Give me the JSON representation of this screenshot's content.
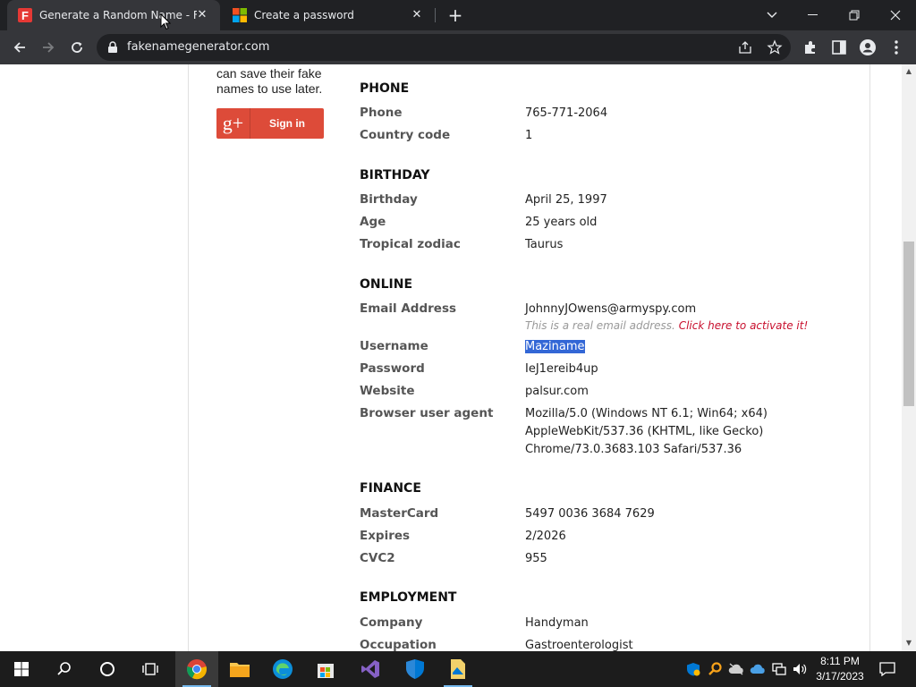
{
  "browser": {
    "tabs": [
      {
        "title": "Generate a Random Name - Fake Name Generator",
        "active": true
      },
      {
        "title": "Create a password",
        "active": false
      }
    ],
    "url": "fakenamegenerator.com"
  },
  "sidebar": {
    "text": "can save their fake names to use later.",
    "signin_label": "Sign in",
    "gplus_glyph": "g+"
  },
  "sections": {
    "phone": {
      "title": "PHONE",
      "phone_label": "Phone",
      "phone_value": "765-771-2064",
      "country_label": "Country code",
      "country_value": "1"
    },
    "birthday": {
      "title": "BIRTHDAY",
      "birthday_label": "Birthday",
      "birthday_value": "April 25, 1997",
      "age_label": "Age",
      "age_value": "25 years old",
      "zodiac_label": "Tropical zodiac",
      "zodiac_value": "Taurus"
    },
    "online": {
      "title": "ONLINE",
      "email_label": "Email Address",
      "email_value": "JohnnyJOwens@armyspy.com",
      "email_note": "This is a real email address.",
      "email_activate": "Click here to activate it!",
      "username_label": "Username",
      "username_value": "Maziname",
      "password_label": "Password",
      "password_value": "IeJ1ereib4up",
      "website_label": "Website",
      "website_value": "palsur.com",
      "ua_label": "Browser user agent",
      "ua_line1": "Mozilla/5.0 (Windows NT 6.1; Win64; x64)",
      "ua_line2": "AppleWebKit/537.36 (KHTML, like Gecko)",
      "ua_line3": "Chrome/73.0.3683.103 Safari/537.36"
    },
    "finance": {
      "title": "FINANCE",
      "card_label": "MasterCard",
      "card_value": "5497 0036 3684 7629",
      "expires_label": "Expires",
      "expires_value": "2/2026",
      "cvc_label": "CVC2",
      "cvc_value": "955"
    },
    "employment": {
      "title": "EMPLOYMENT",
      "company_label": "Company",
      "company_value": "Handyman",
      "occupation_label": "Occupation",
      "occupation_value": "Gastroenterologist"
    }
  },
  "taskbar": {
    "time": "8:11 PM",
    "date": "3/17/2023"
  },
  "colors": {
    "accent": "#dd4b39",
    "selection": "#3367d6",
    "activate_link": "#c8102e"
  }
}
